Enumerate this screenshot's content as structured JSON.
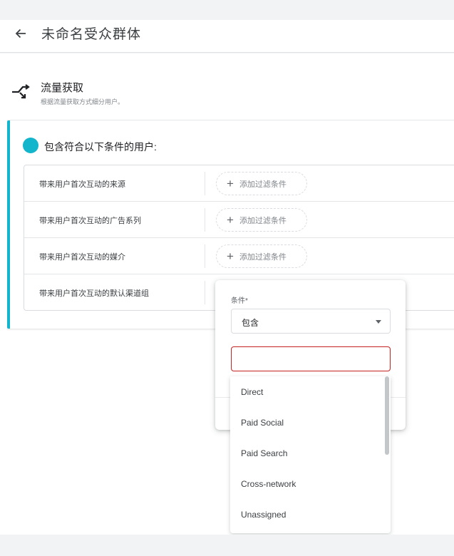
{
  "header": {
    "title": "未命名受众群体"
  },
  "section": {
    "title": "流量获取",
    "subtitle": "根据流量获取方式细分用户。"
  },
  "card": {
    "include_label": "包含符合以下条件的用户:",
    "accent_color": "#12b5cb"
  },
  "rows": [
    {
      "label": "带来用户首次互动的来源",
      "add_filter": "添加过滤条件"
    },
    {
      "label": "带来用户首次互动的广告系列",
      "add_filter": "添加过滤条件"
    },
    {
      "label": "带来用户首次互动的媒介",
      "add_filter": "添加过滤条件"
    },
    {
      "label": "带来用户首次互动的默认渠道组"
    }
  ],
  "popup": {
    "condition_label": "条件*",
    "condition_value": "包含",
    "input_value": "",
    "input_border_color": "#c5221f",
    "options": [
      "Direct",
      "Paid Social",
      "Paid Search",
      "Cross-network",
      "Unassigned"
    ]
  },
  "icons": {
    "back": "arrow-back-icon",
    "section": "merge-arrows-icon",
    "caret": "caret-down-icon",
    "add": "plus-icon"
  }
}
